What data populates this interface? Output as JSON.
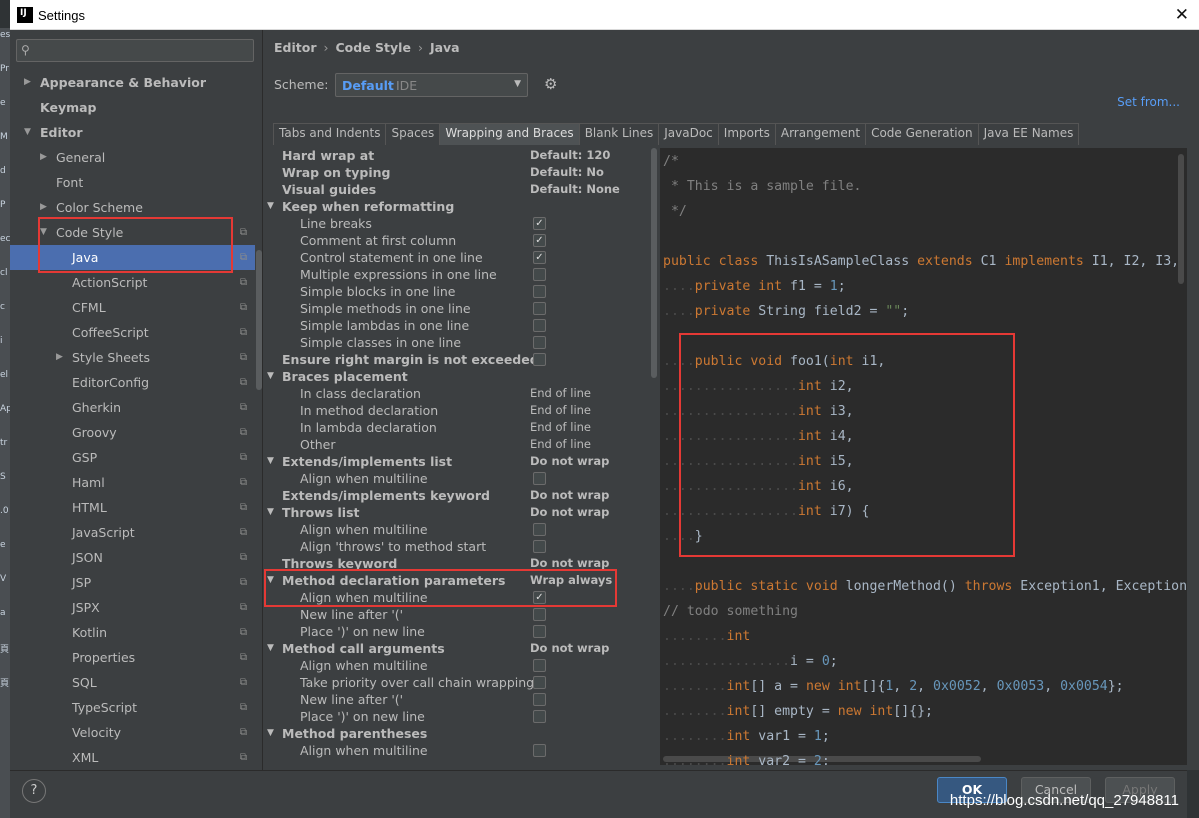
{
  "window": {
    "title": "Settings",
    "logo_text": "IJ",
    "close": "✕"
  },
  "left_strip_text": [
    "es",
    "Pr",
    "e",
    "M",
    "d",
    "P",
    "ec",
    "cl",
    "c",
    "i",
    "el",
    "Ap",
    "tr",
    "S",
    ".0",
    "e",
    "V",
    "a",
    "頁",
    "頁"
  ],
  "search": {
    "placeholder": "",
    "icon": "search-icon"
  },
  "tree": [
    {
      "label": "Appearance & Behavior",
      "arrow": "▶",
      "bold": true
    },
    {
      "label": "Keymap",
      "bold": true
    },
    {
      "label": "Editor",
      "arrow": "▼",
      "bold": true
    },
    {
      "label": "General",
      "arrow": "▶"
    },
    {
      "label": "Font"
    },
    {
      "label": "Color Scheme",
      "arrow": "▶"
    },
    {
      "label": "Code Style",
      "arrow": "▼",
      "copy": "⧉"
    },
    {
      "label": "Java",
      "copy": "⧉",
      "selected": true
    },
    {
      "label": "ActionScript",
      "copy": "⧉"
    },
    {
      "label": "CFML",
      "copy": "⧉"
    },
    {
      "label": "CoffeeScript",
      "copy": "⧉"
    },
    {
      "label": "Style Sheets",
      "arrow": "▶",
      "copy": "⧉"
    },
    {
      "label": "EditorConfig",
      "copy": "⧉"
    },
    {
      "label": "Gherkin",
      "copy": "⧉"
    },
    {
      "label": "Groovy",
      "copy": "⧉"
    },
    {
      "label": "GSP",
      "copy": "⧉"
    },
    {
      "label": "Haml",
      "copy": "⧉"
    },
    {
      "label": "HTML",
      "copy": "⧉"
    },
    {
      "label": "JavaScript",
      "copy": "⧉"
    },
    {
      "label": "JSON",
      "copy": "⧉"
    },
    {
      "label": "JSP",
      "copy": "⧉"
    },
    {
      "label": "JSPX",
      "copy": "⧉"
    },
    {
      "label": "Kotlin",
      "copy": "⧉"
    },
    {
      "label": "Properties",
      "copy": "⧉"
    },
    {
      "label": "SQL",
      "copy": "⧉"
    },
    {
      "label": "TypeScript",
      "copy": "⧉"
    },
    {
      "label": "Velocity",
      "copy": "⧉"
    },
    {
      "label": "XML",
      "copy": "⧉"
    }
  ],
  "breadcrumb": [
    "Editor",
    "Code Style",
    "Java"
  ],
  "breadcrumb_sep": "›",
  "scheme": {
    "label": "Scheme:",
    "value": "Default",
    "type": "IDE",
    "dropdown": "▼",
    "gear": "⚙",
    "set_from": "Set from..."
  },
  "tabs": [
    "Tabs and Indents",
    "Spaces",
    "Wrapping and Braces",
    "Blank Lines",
    "JavaDoc",
    "Imports",
    "Arrangement",
    "Code Generation",
    "Java EE Names"
  ],
  "active_tab": "Wrapping and Braces",
  "options": [
    {
      "label": "Hard wrap at",
      "value": "Default: 120",
      "header": true
    },
    {
      "label": "Wrap on typing",
      "value": "Default: No",
      "header": true
    },
    {
      "label": "Visual guides",
      "value": "Default: None",
      "header": true
    },
    {
      "label": "Keep when reformatting",
      "header": true,
      "group": true
    },
    {
      "label": "Line breaks",
      "checkbox": true
    },
    {
      "label": "Comment at first column",
      "checkbox": true
    },
    {
      "label": "Control statement in one line",
      "checkbox": true
    },
    {
      "label": "Multiple expressions in one line",
      "checkbox": false
    },
    {
      "label": "Simple blocks in one line",
      "checkbox": false
    },
    {
      "label": "Simple methods in one line",
      "checkbox": false
    },
    {
      "label": "Simple lambdas in one line",
      "checkbox": false
    },
    {
      "label": "Simple classes in one line",
      "checkbox": false
    },
    {
      "label": "Ensure right margin is not exceeded",
      "header": true,
      "checkbox": false
    },
    {
      "label": "Braces placement",
      "header": true,
      "group": true
    },
    {
      "label": "In class declaration",
      "value": "End of line"
    },
    {
      "label": "In method declaration",
      "value": "End of line"
    },
    {
      "label": "In lambda declaration",
      "value": "End of line"
    },
    {
      "label": "Other",
      "value": "End of line"
    },
    {
      "label": "Extends/implements list",
      "header": true,
      "group": true,
      "value": "Do not wrap"
    },
    {
      "label": "Align when multiline",
      "checkbox": false
    },
    {
      "label": "Extends/implements keyword",
      "header": true,
      "value": "Do not wrap"
    },
    {
      "label": "Throws list",
      "header": true,
      "group": true,
      "value": "Do not wrap"
    },
    {
      "label": "Align when multiline",
      "checkbox": false
    },
    {
      "label": "Align 'throws' to method start",
      "checkbox": false
    },
    {
      "label": "Throws keyword",
      "header": true,
      "value": "Do not wrap"
    },
    {
      "label": "Method declaration parameters",
      "header": true,
      "group": true,
      "value": "Wrap always"
    },
    {
      "label": "Align when multiline",
      "checkbox": true
    },
    {
      "label": "New line after '('",
      "checkbox": false
    },
    {
      "label": "Place ')' on new line",
      "checkbox": false
    },
    {
      "label": "Method call arguments",
      "header": true,
      "group": true,
      "value": "Do not wrap"
    },
    {
      "label": "Align when multiline",
      "checkbox": false
    },
    {
      "label": "Take priority over call chain wrapping",
      "checkbox": false
    },
    {
      "label": "New line after '('",
      "checkbox": false
    },
    {
      "label": "Place ')' on new line",
      "checkbox": false
    },
    {
      "label": "Method parentheses",
      "header": true,
      "group": true
    },
    {
      "label": "Align when multiline",
      "checkbox": false
    }
  ],
  "code_lines": [
    [
      [
        "cm",
        "/*"
      ]
    ],
    [
      [
        "cm",
        " * This is a sample file."
      ]
    ],
    [
      [
        "cm",
        " */"
      ]
    ],
    [],
    [
      [
        "kw",
        "public class "
      ],
      [
        "df",
        "ThisIsASampleClass "
      ],
      [
        "kw",
        "extends "
      ],
      [
        "df",
        "C1 "
      ],
      [
        "kw",
        "implements "
      ],
      [
        "df",
        "I1, I2, I3, I"
      ]
    ],
    [
      [
        "ws",
        "...."
      ],
      [
        "kw",
        "private int "
      ],
      [
        "df",
        "f1 = "
      ],
      [
        "nm",
        "1"
      ],
      [
        "df",
        ";"
      ]
    ],
    [
      [
        "ws",
        "...."
      ],
      [
        "kw",
        "private "
      ],
      [
        "df",
        "String field2 = "
      ],
      [
        "st",
        "\"\""
      ],
      [
        "df",
        ";"
      ]
    ],
    [],
    [
      [
        "ws",
        "...."
      ],
      [
        "kw",
        "public void "
      ],
      [
        "df",
        "foo1("
      ],
      [
        "kw",
        "int "
      ],
      [
        "df",
        "i1,"
      ]
    ],
    [
      [
        "ws",
        "................."
      ],
      [
        "kw",
        "int "
      ],
      [
        "df",
        "i2,"
      ]
    ],
    [
      [
        "ws",
        "................."
      ],
      [
        "kw",
        "int "
      ],
      [
        "df",
        "i3,"
      ]
    ],
    [
      [
        "ws",
        "................."
      ],
      [
        "kw",
        "int "
      ],
      [
        "df",
        "i4,"
      ]
    ],
    [
      [
        "ws",
        "................."
      ],
      [
        "kw",
        "int "
      ],
      [
        "df",
        "i5,"
      ]
    ],
    [
      [
        "ws",
        "................."
      ],
      [
        "kw",
        "int "
      ],
      [
        "df",
        "i6,"
      ]
    ],
    [
      [
        "ws",
        "................."
      ],
      [
        "kw",
        "int "
      ],
      [
        "df",
        "i7) {"
      ]
    ],
    [
      [
        "ws",
        "...."
      ],
      [
        "df",
        "}"
      ]
    ],
    [],
    [
      [
        "ws",
        "...."
      ],
      [
        "kw",
        "public static void "
      ],
      [
        "df",
        "longerMethod() "
      ],
      [
        "kw",
        "throws "
      ],
      [
        "df",
        "Exception1, Exception"
      ]
    ],
    [
      [
        "cm",
        "// todo something"
      ]
    ],
    [
      [
        "ws",
        "........"
      ],
      [
        "kw",
        "int"
      ]
    ],
    [
      [
        "ws",
        "................"
      ],
      [
        "df",
        "i = "
      ],
      [
        "nm",
        "0"
      ],
      [
        "df",
        ";"
      ]
    ],
    [
      [
        "ws",
        "........"
      ],
      [
        "kw",
        "int"
      ],
      [
        "df",
        "[] a = "
      ],
      [
        "kw",
        "new int"
      ],
      [
        "df",
        "[]{"
      ],
      [
        "nm",
        "1"
      ],
      [
        "df",
        ", "
      ],
      [
        "nm",
        "2"
      ],
      [
        "df",
        ", "
      ],
      [
        "nm",
        "0x0052"
      ],
      [
        "df",
        ", "
      ],
      [
        "nm",
        "0x0053"
      ],
      [
        "df",
        ", "
      ],
      [
        "nm",
        "0x0054"
      ],
      [
        "df",
        "};"
      ]
    ],
    [
      [
        "ws",
        "........"
      ],
      [
        "kw",
        "int"
      ],
      [
        "df",
        "[] empty = "
      ],
      [
        "kw",
        "new int"
      ],
      [
        "df",
        "[]{};"
      ]
    ],
    [
      [
        "ws",
        "........"
      ],
      [
        "kw",
        "int "
      ],
      [
        "df",
        "var1 = "
      ],
      [
        "nm",
        "1"
      ],
      [
        "df",
        ";"
      ]
    ],
    [
      [
        "ws",
        "........"
      ],
      [
        "kw",
        "int "
      ],
      [
        "df",
        "var2 = "
      ],
      [
        "nm",
        "2"
      ],
      [
        "df",
        ";"
      ]
    ]
  ],
  "buttons": {
    "help": "?",
    "ok": "OK",
    "cancel": "Cancel",
    "apply": "Apply"
  },
  "watermark": "https://blog.csdn.net/qq_27948811"
}
